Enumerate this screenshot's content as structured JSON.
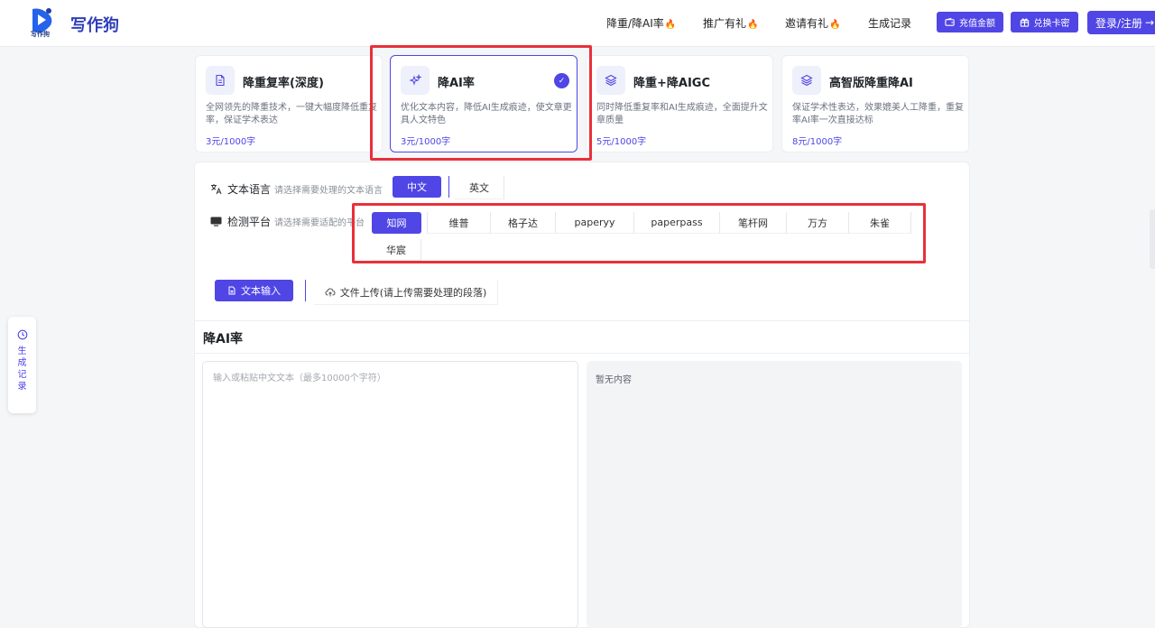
{
  "brand": {
    "logo_small": "写作狗",
    "name": "写作狗"
  },
  "nav": {
    "links": [
      {
        "label": "降重/降AI率",
        "hot": true
      },
      {
        "label": "推广有礼",
        "hot": true
      },
      {
        "label": "邀请有礼",
        "hot": true
      },
      {
        "label": "生成记录",
        "hot": false
      }
    ],
    "recharge": "充值金额",
    "redeem": "兑换卡密",
    "login": "登录/注册",
    "login_arrow": "→",
    "flame": "🔥"
  },
  "cards": [
    {
      "title": "降重复率(深度)",
      "desc": "全网领先的降重技术，一键大幅度降低重复率，保证学术表达",
      "price": "3元/1000字",
      "icon": "document-icon",
      "selected": false
    },
    {
      "title": "降AI率",
      "desc": "优化文本内容，降低AI生成痕迹，使文章更具人文特色",
      "price": "3元/1000字",
      "icon": "sparkles-icon",
      "selected": true,
      "check": "✓"
    },
    {
      "title": "降重+降AIGC",
      "desc": "同时降低重复率和AI生成痕迹，全面提升文章质量",
      "price": "5元/1000字",
      "icon": "layers-icon",
      "selected": false
    },
    {
      "title": "高智版降重降AI",
      "desc": "保证学术性表达，效果媲美人工降重，重复率AI率一次直接达标",
      "price": "8元/1000字",
      "icon": "layers-icon",
      "selected": false
    }
  ],
  "language": {
    "label": "文本语言",
    "hint": "请选择需要处理的文本语言",
    "options": [
      "中文",
      "英文"
    ],
    "selected": "中文"
  },
  "platform": {
    "label": "检测平台",
    "hint": "请选择需要适配的平台",
    "options": [
      "知网",
      "维普",
      "格子达",
      "paperyy",
      "paperpass",
      "笔杆网",
      "万方",
      "朱雀",
      "华宸"
    ],
    "selected": "知网"
  },
  "input_tabs": {
    "text": "文本输入",
    "upload": "文件上传(请上传需要处理的段落)"
  },
  "section": {
    "title": "降AI率",
    "input_placeholder": "输入或粘贴中文文本（最多10000个字符）",
    "output_empty": "暂无内容"
  },
  "floating": {
    "history": "生成记录"
  },
  "colors": {
    "accent": "#4f46e5",
    "highlight": "#e8303a",
    "flame": "#f97316"
  }
}
